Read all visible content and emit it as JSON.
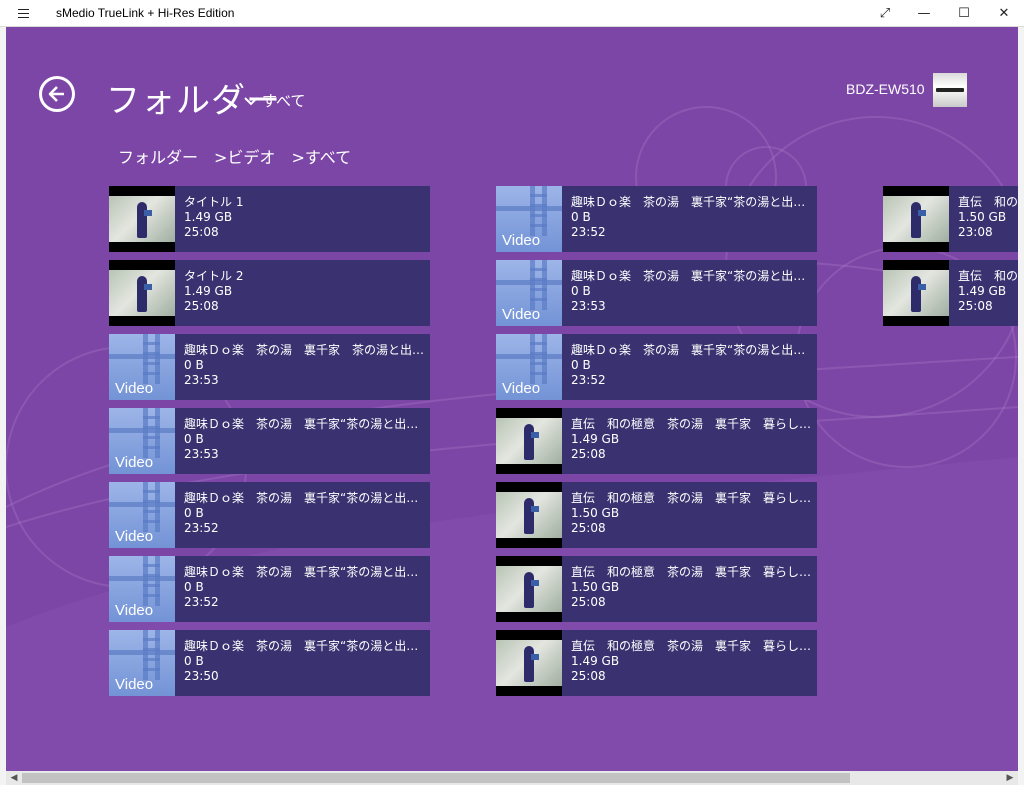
{
  "window": {
    "title": "sMedio TrueLink + Hi-Res Edition",
    "buttons": [
      "⤢",
      "—",
      "☐",
      "✕"
    ]
  },
  "header": {
    "title": "フォルダー",
    "filter_label": "すべて",
    "device_name": "BDZ-EW510"
  },
  "breadcrumb": [
    "フォルダー",
    ">ビデオ",
    ">すべて"
  ],
  "columns": [
    [
      {
        "thumb": "photo",
        "title": "タイトル 1",
        "size": "1.49 GB",
        "duration": "25:08"
      },
      {
        "thumb": "photo",
        "title": "タイトル 2",
        "size": "1.49 GB",
        "duration": "25:08"
      },
      {
        "thumb": "video",
        "title": "趣味Ｄｏ楽　茶の湯　裏千家　茶の湯と出会う…",
        "size": "0 B",
        "duration": "23:53"
      },
      {
        "thumb": "video",
        "title": "趣味Ｄｏ楽　茶の湯　裏千家“茶の湯と出会う”…",
        "size": "0 B",
        "duration": "23:53"
      },
      {
        "thumb": "video",
        "title": "趣味Ｄｏ楽　茶の湯　裏千家“茶の湯と出会う”…",
        "size": "0 B",
        "duration": "23:52"
      },
      {
        "thumb": "video",
        "title": "趣味Ｄｏ楽　茶の湯　裏千家“茶の湯と出会う”…",
        "size": "0 B",
        "duration": "23:52"
      },
      {
        "thumb": "video",
        "title": "趣味Ｄｏ楽　茶の湯　裏千家“茶の湯と出会う”…",
        "size": "0 B",
        "duration": "23:50"
      }
    ],
    [
      {
        "thumb": "video",
        "title": "趣味Ｄｏ楽　茶の湯　裏千家“茶の湯と出会…",
        "size": "0 B",
        "duration": "23:52"
      },
      {
        "thumb": "video",
        "title": "趣味Ｄｏ楽　茶の湯　裏千家“茶の湯と出会…",
        "size": "0 B",
        "duration": "23:53"
      },
      {
        "thumb": "video",
        "title": "趣味Ｄｏ楽　茶の湯　裏千家“茶の湯と出会…",
        "size": "0 B",
        "duration": "23:52"
      },
      {
        "thumb": "photo",
        "title": "直伝　和の極意　茶の湯　裏千家　暮らしにお…",
        "size": "1.49 GB",
        "duration": "25:08"
      },
      {
        "thumb": "photo",
        "title": "直伝　和の極意　茶の湯　裏千家　暮らしにお…",
        "size": "1.50 GB",
        "duration": "25:08"
      },
      {
        "thumb": "photo",
        "title": "直伝　和の極意　茶の湯　裏千家　暮らしにお…",
        "size": "1.50 GB",
        "duration": "25:08"
      },
      {
        "thumb": "photo",
        "title": "直伝　和の極意　茶の湯　裏千家　暮らしにお…",
        "size": "1.49 GB",
        "duration": "25:08"
      }
    ],
    [
      {
        "thumb": "photo",
        "title": "直伝　和の極",
        "size": "1.50 GB",
        "duration": "23:08"
      },
      {
        "thumb": "photo",
        "title": "直伝　和の極",
        "size": "1.49 GB",
        "duration": "25:08"
      }
    ]
  ],
  "video_thumb_label": "Video",
  "colors": {
    "background": "#7c46a6",
    "tile": "#3a3270",
    "text": "#ffffff"
  }
}
